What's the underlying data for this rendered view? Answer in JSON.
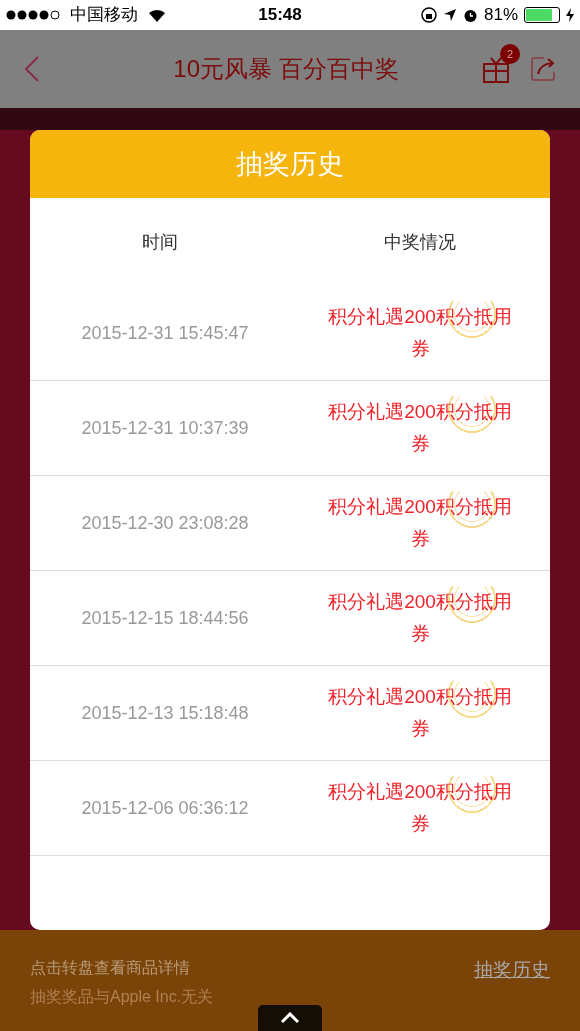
{
  "status_bar": {
    "carrier": "中国移动",
    "time": "15:48",
    "battery": "81%"
  },
  "nav": {
    "title": "10元风暴 百分百中奖",
    "badge": "2"
  },
  "modal": {
    "title": "抽奖历史",
    "columns": [
      "时间",
      "中奖情况"
    ],
    "rows": [
      {
        "time": "2015-12-31 15:45:47",
        "prize": "积分礼遇200积分抵用券"
      },
      {
        "time": "2015-12-31 10:37:39",
        "prize": "积分礼遇200积分抵用券"
      },
      {
        "time": "2015-12-30 23:08:28",
        "prize": "积分礼遇200积分抵用券"
      },
      {
        "time": "2015-12-15 18:44:56",
        "prize": "积分礼遇200积分抵用券"
      },
      {
        "time": "2015-12-13 15:18:48",
        "prize": "积分礼遇200积分抵用券"
      },
      {
        "time": "2015-12-06 06:36:12",
        "prize": "积分礼遇200积分抵用券"
      }
    ]
  },
  "footer": {
    "hint": "点击转盘查看商品详情",
    "disclaimer": "抽奖奖品与Apple Inc.无关",
    "link": "抽奖历史"
  }
}
